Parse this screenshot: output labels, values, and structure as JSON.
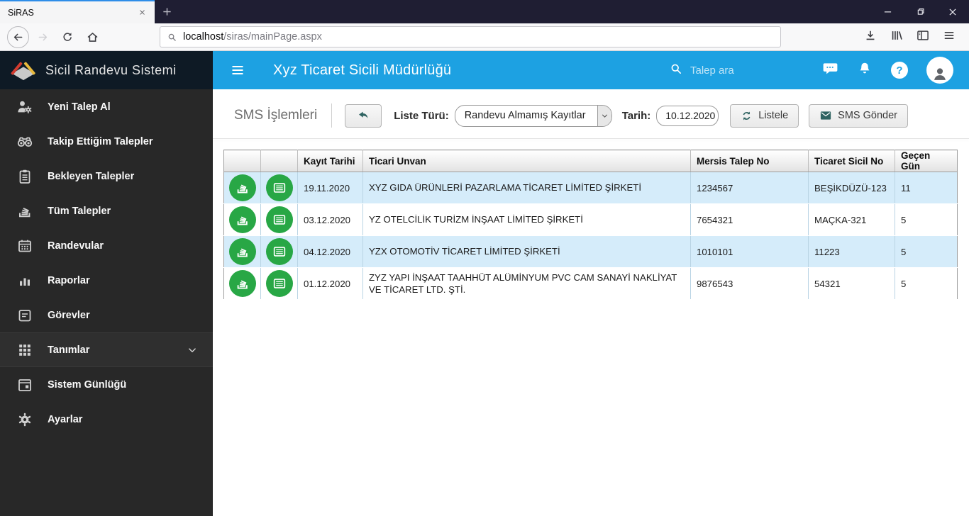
{
  "browser": {
    "tab_title": "SiRAS",
    "url_host": "localhost",
    "url_path": "/siras/mainPage.aspx"
  },
  "sidebar": {
    "brand": "Sicil Randevu Sistemi",
    "items": [
      {
        "id": "yeni-talep-al",
        "label": "Yeni Talep Al",
        "icon": "person-gear",
        "expandable": false
      },
      {
        "id": "takip-ettigim-talepler",
        "label": "Takip Ettiğim Talepler",
        "icon": "binoculars",
        "expandable": false
      },
      {
        "id": "bekleyen-talepler",
        "label": "Bekleyen Talepler",
        "icon": "clipboard",
        "expandable": false
      },
      {
        "id": "tum-talepler",
        "label": "Tüm Talepler",
        "icon": "stack",
        "expandable": false
      },
      {
        "id": "randevular",
        "label": "Randevular",
        "icon": "calendar",
        "expandable": false
      },
      {
        "id": "raporlar",
        "label": "Raporlar",
        "icon": "chart",
        "expandable": false
      },
      {
        "id": "gorevler",
        "label": "Görevler",
        "icon": "note",
        "expandable": false
      },
      {
        "id": "tanimlar",
        "label": "Tanımlar",
        "icon": "grid",
        "expandable": true
      },
      {
        "id": "sistem-gunlugu",
        "label": "Sistem Günlüğü",
        "icon": "calendar-box",
        "expandable": false
      },
      {
        "id": "ayarlar",
        "label": "Ayarlar",
        "icon": "gear",
        "expandable": false
      }
    ]
  },
  "header": {
    "title": "Xyz Ticaret Sicili Müdürlüğü",
    "search_placeholder": "Talep ara",
    "help_glyph": "?"
  },
  "toolbar": {
    "heading": "SMS İşlemleri",
    "list_type_label": "Liste Türü:",
    "list_type_value": "Randevu Almamış Kayıtlar",
    "date_label": "Tarih:",
    "date_value": "10.12.2020",
    "list_button": "Listele",
    "sms_button": "SMS Gönder"
  },
  "table": {
    "columns": [
      "",
      "",
      "Kayıt Tarihi",
      "Ticari Unvan",
      "Mersis Talep No",
      "Ticaret Sicil No",
      "Geçen Gün"
    ],
    "rows": [
      {
        "date": "19.11.2020",
        "name": "XYZ GIDA ÜRÜNLERİ PAZARLAMA TİCARET LİMİTED ŞİRKETİ",
        "mersis": "1234567",
        "sicil": "BEŞİKDÜZÜ-123",
        "days": "11"
      },
      {
        "date": "03.12.2020",
        "name": "YZ OTELCİLİK TURİZM İNŞAAT LİMİTED ŞİRKETİ",
        "mersis": "7654321",
        "sicil": "MAÇKA-321",
        "days": "5"
      },
      {
        "date": "04.12.2020",
        "name": "YZX OTOMOTİV TİCARET LİMİTED ŞİRKETİ",
        "mersis": "1010101",
        "sicil": "11223",
        "days": "5"
      },
      {
        "date": "01.12.2020",
        "name": "ZYZ YAPI İNŞAAT TAAHHÜT ALÜMİNYUM PVC CAM SANAYİ NAKLİYAT VE TİCARET LTD. ŞTİ.",
        "mersis": "9876543",
        "sicil": "54321",
        "days": "5"
      }
    ]
  },
  "colors": {
    "accent": "#1da1e2",
    "titlebar": "#1f1e33",
    "tab_line": "#2e8de8",
    "sidebar_bg": "#282828",
    "brand_bg": "#0e1a25",
    "green": "#28a745",
    "row_alt": "#d5ecfa",
    "icon_teal": "#2f6361"
  }
}
